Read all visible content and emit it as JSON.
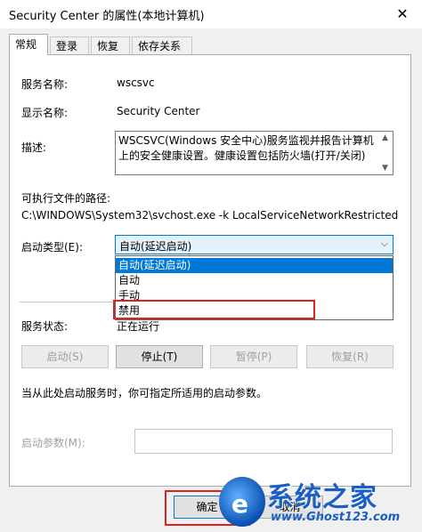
{
  "window": {
    "title": "Security Center 的属性(本地计算机)",
    "close_glyph": "✕"
  },
  "tabs": [
    {
      "label": "常规"
    },
    {
      "label": "登录"
    },
    {
      "label": "恢复"
    },
    {
      "label": "依存关系"
    }
  ],
  "general": {
    "service_name_label": "服务名称:",
    "service_name_value": "wscsvc",
    "display_name_label": "显示名称:",
    "display_name_value": "Security Center",
    "description_label": "描述:",
    "description_value": "WSCSVC(Windows 安全中心)服务监视并报告计算机上的安全健康设置。健康设置包括防火墙(打开/关闭)",
    "exe_path_label": "可执行文件的路径:",
    "exe_path_value": "C:\\WINDOWS\\System32\\svchost.exe -k LocalServiceNetworkRestricted",
    "startup_type_label": "启动类型(E):",
    "startup_type_value": "自动(延迟启动)",
    "startup_options": [
      "自动(延迟启动)",
      "自动",
      "手动",
      "禁用"
    ],
    "service_status_label": "服务状态:",
    "service_status_value": "正在运行",
    "buttons": {
      "start": "启动(S)",
      "stop": "停止(T)",
      "pause": "暂停(P)",
      "resume": "恢复(R)"
    },
    "hint": "当从此处启动服务时，你可指定所适用的启动参数。",
    "start_params_label": "启动参数(M):",
    "start_params_value": ""
  },
  "footer": {
    "ok": "确定",
    "cancel": "取消"
  },
  "watermark": {
    "title": "系统之家",
    "url": "www.Ghost123.com"
  }
}
